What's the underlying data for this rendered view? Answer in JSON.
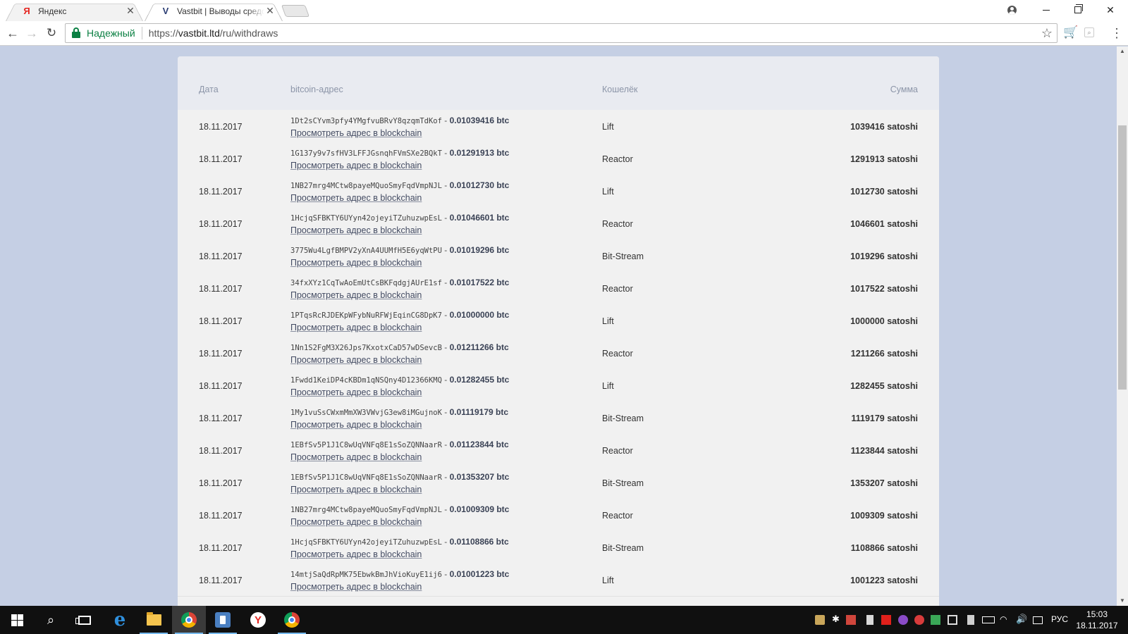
{
  "browser": {
    "tabs": [
      {
        "title": "Яндекс",
        "favicon": "Я",
        "active": false
      },
      {
        "title": "Vastbit | Выводы средств",
        "favicon": "V",
        "active": true
      }
    ],
    "secure_label": "Надежный",
    "url_prefix": "https://",
    "url_host": "vastbit.ltd",
    "url_path": "/ru/withdraws",
    "icons": [
      "back-arrow-icon",
      "forward-arrow-icon",
      "reload-icon",
      "lock-icon",
      "star-icon",
      "cart-icon",
      "search-icon",
      "menu-icon",
      "profile-icon"
    ]
  },
  "table": {
    "headers": {
      "date": "Дата",
      "address": "bitcoin-адрес",
      "wallet": "Кошелёк",
      "sum": "Сумма"
    },
    "link_label": "Просмотреть адрес в blockchain",
    "rows": [
      {
        "date": "18.11.2017",
        "address": "1Dt2sCYvm3pfy4YMgfvuBRvY8qzqmTdKof",
        "btc": "0.01039416 btc",
        "wallet": "Lift",
        "sum": "1039416 satoshi"
      },
      {
        "date": "18.11.2017",
        "address": "1G137y9v7sfHV3LFFJGsnqhFVmSXe2BQkT",
        "btc": "0.01291913 btc",
        "wallet": "Reactor",
        "sum": "1291913 satoshi"
      },
      {
        "date": "18.11.2017",
        "address": "1NB27mrg4MCtw8payeMQuoSmyFqdVmpNJL",
        "btc": "0.01012730 btc",
        "wallet": "Lift",
        "sum": "1012730 satoshi"
      },
      {
        "date": "18.11.2017",
        "address": "1HcjqSFBKTY6UYyn42ojeyiTZuhuzwpEsL",
        "btc": "0.01046601 btc",
        "wallet": "Reactor",
        "sum": "1046601 satoshi"
      },
      {
        "date": "18.11.2017",
        "address": "3775Wu4LgfBMPV2yXnA4UUMfH5E6yqWtPU",
        "btc": "0.01019296 btc",
        "wallet": "Bit-Stream",
        "sum": "1019296 satoshi"
      },
      {
        "date": "18.11.2017",
        "address": "34fxXYz1CqTwAoEmUtCsBKFqdgjAUrE1sf",
        "btc": "0.01017522 btc",
        "wallet": "Reactor",
        "sum": "1017522 satoshi"
      },
      {
        "date": "18.11.2017",
        "address": "1PTqsRcRJDEKpWFybNuRFWjEqinCG8DpK7",
        "btc": "0.01000000 btc",
        "wallet": "Lift",
        "sum": "1000000 satoshi"
      },
      {
        "date": "18.11.2017",
        "address": "1Nn1S2FgM3X26Jps7KxotxCaD57wDSevcB",
        "btc": "0.01211266 btc",
        "wallet": "Reactor",
        "sum": "1211266 satoshi"
      },
      {
        "date": "18.11.2017",
        "address": "1Fwdd1KeiDP4cKBDm1qNSQny4D12366KMQ",
        "btc": "0.01282455 btc",
        "wallet": "Lift",
        "sum": "1282455 satoshi"
      },
      {
        "date": "18.11.2017",
        "address": "1My1vuSsCWxmMmXW3VWvjG3ew8iMGujnoK",
        "btc": "0.01119179 btc",
        "wallet": "Bit-Stream",
        "sum": "1119179 satoshi"
      },
      {
        "date": "18.11.2017",
        "address": "1EBfSv5P1J1C8wUqVNFq8E1sSoZQNNaarR",
        "btc": "0.01123844 btc",
        "wallet": "Reactor",
        "sum": "1123844 satoshi"
      },
      {
        "date": "18.11.2017",
        "address": "1EBfSv5P1J1C8wUqVNFq8E1sSoZQNNaarR",
        "btc": "0.01353207 btc",
        "wallet": "Bit-Stream",
        "sum": "1353207 satoshi"
      },
      {
        "date": "18.11.2017",
        "address": "1NB27mrg4MCtw8payeMQuoSmyFqdVmpNJL",
        "btc": "0.01009309 btc",
        "wallet": "Reactor",
        "sum": "1009309 satoshi"
      },
      {
        "date": "18.11.2017",
        "address": "1HcjqSFBKTY6UYyn42ojeyiTZuhuzwpEsL",
        "btc": "0.01108866 btc",
        "wallet": "Bit-Stream",
        "sum": "1108866 satoshi"
      },
      {
        "date": "18.11.2017",
        "address": "14mtjSaQdRpMK75EbwkBmJhVioKuyE1ij6",
        "btc": "0.01001223 btc",
        "wallet": "Lift",
        "sum": "1001223 satoshi"
      }
    ]
  },
  "taskbar": {
    "language": "РУС",
    "time": "15:03",
    "date": "18.11.2017"
  }
}
